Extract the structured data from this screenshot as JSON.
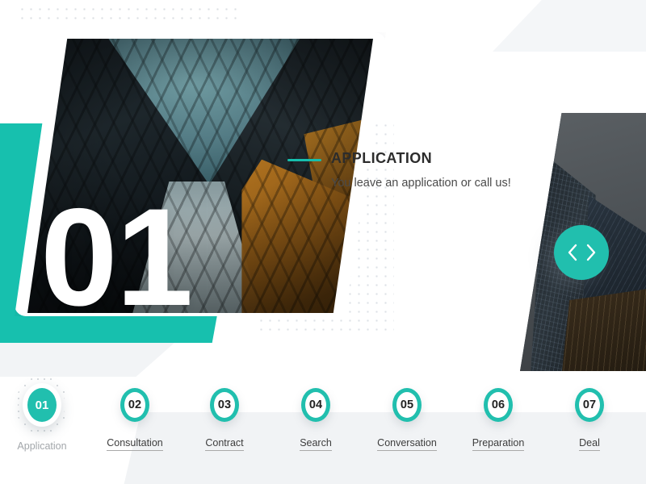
{
  "slide": {
    "number": "01",
    "title": "APPLICATION",
    "subtitle": "You leave an application or call us!"
  },
  "nav": {
    "prev_label": "Previous slide",
    "next_label": "Next slide",
    "prev_icon": "chevron-left-icon",
    "next_icon": "chevron-right-icon"
  },
  "colors": {
    "accent": "#21bfae",
    "accent_slab": "#17c0ae",
    "band_grey": "#f1f3f5",
    "title_text": "#2c2c2c",
    "label_text": "#3d3d3d",
    "active_label_text": "#a2a6aa"
  },
  "stepper": {
    "active_index": 0,
    "steps": [
      {
        "number": "01",
        "label": "Application"
      },
      {
        "number": "02",
        "label": "Consultation"
      },
      {
        "number": "03",
        "label": "Contract"
      },
      {
        "number": "04",
        "label": "Search"
      },
      {
        "number": "05",
        "label": "Conversation"
      },
      {
        "number": "06",
        "label": "Preparation"
      },
      {
        "number": "07",
        "label": "Deal"
      }
    ]
  },
  "media": {
    "main_photo_alt": "Upward view between modern glass buildings",
    "side_photo_alt": "Skyscrapers seen from below"
  }
}
